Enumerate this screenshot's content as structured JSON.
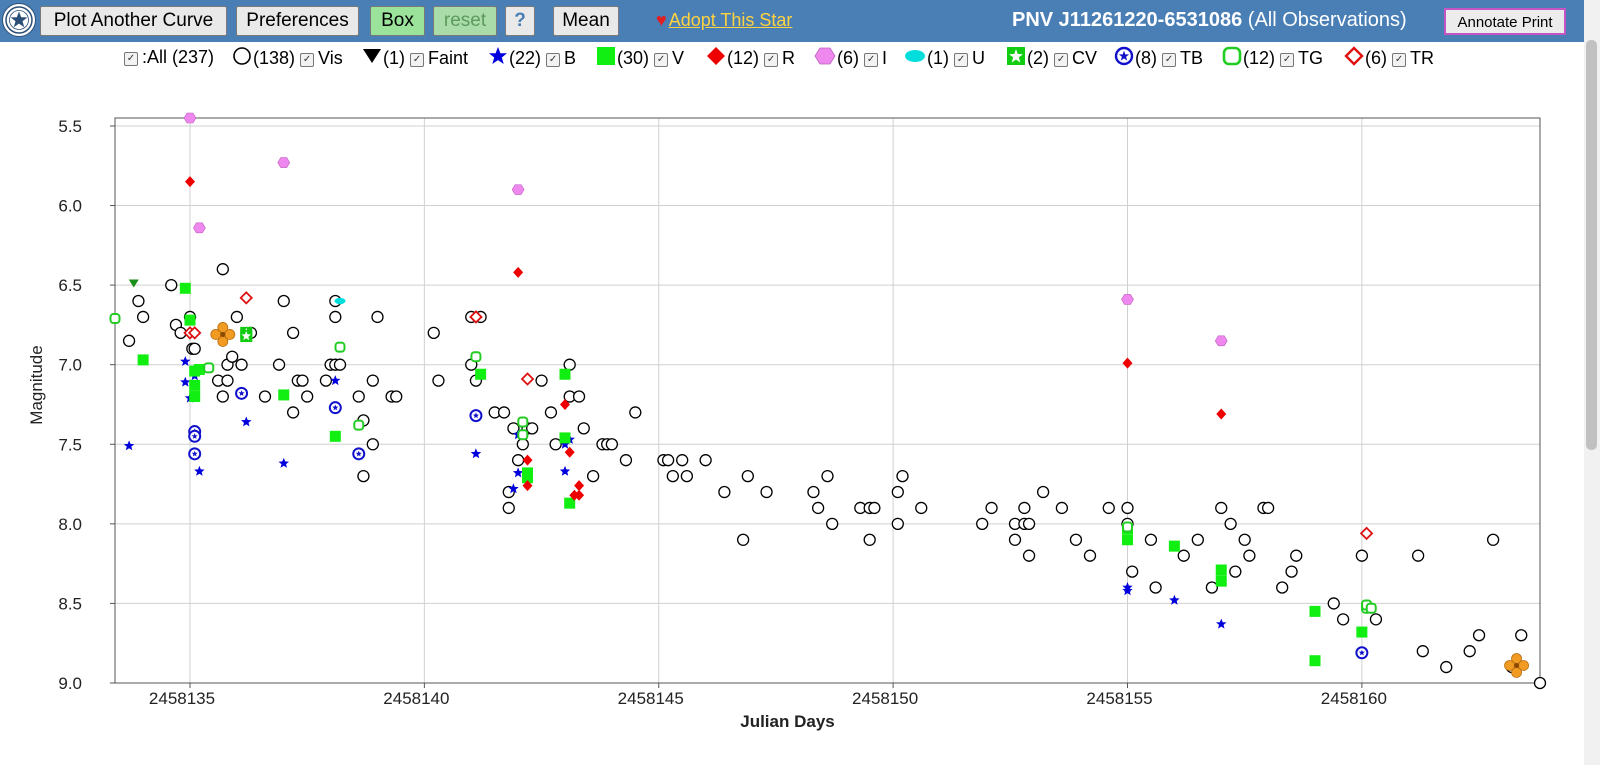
{
  "toolbar": {
    "plot_another_curve": "Plot Another Curve",
    "preferences": "Preferences",
    "box": "Box",
    "reset": "reset",
    "help": "?",
    "mean": "Mean",
    "adopt_heart": "♥",
    "adopt_label": "Adopt This Star",
    "star_name": "PNV J11261220-6531086",
    "star_suffix": "(All Observations)",
    "annotate_print": "Annotate Print"
  },
  "colors": {
    "toolbar_bg": "#4a7fb6",
    "vis": "#000000",
    "faint": "#1a8f1a",
    "B": "#0000dd",
    "V": "#11ee11",
    "R": "#ee0000",
    "I": "#ee88ee",
    "U": "#00dddd",
    "CV": "#11cc11",
    "TB": "#1111cc",
    "TG": "#22cc22",
    "TR": "#dd1111",
    "highlight": "#f29b22"
  },
  "legend": {
    "all": ":All (237)",
    "items": [
      {
        "key": "vis",
        "count": "(138)",
        "label": "Vis"
      },
      {
        "key": "faint",
        "count": "(1)",
        "label": "Faint"
      },
      {
        "key": "B",
        "count": "(22)",
        "label": "B"
      },
      {
        "key": "V",
        "count": "(30)",
        "label": "V"
      },
      {
        "key": "R",
        "count": "(12)",
        "label": "R"
      },
      {
        "key": "I",
        "count": "(6)",
        "label": "I"
      },
      {
        "key": "U",
        "count": "(1)",
        "label": "U"
      },
      {
        "key": "CV",
        "count": "(2)",
        "label": "CV"
      },
      {
        "key": "TB",
        "count": "(8)",
        "label": "TB"
      },
      {
        "key": "TG",
        "count": "(12)",
        "label": "TG"
      },
      {
        "key": "TR",
        "count": "(6)",
        "label": "TR"
      }
    ]
  },
  "chart_data": {
    "type": "scatter",
    "title": "",
    "xlabel": "Julian Days",
    "ylabel": "Magnitude",
    "xlim": [
      2458133.4,
      2458163.8
    ],
    "ylim": [
      5.45,
      9.0
    ],
    "y_inverted": true,
    "grid": true,
    "x_ticks": [
      2458135,
      2458140,
      2458145,
      2458150,
      2458155,
      2458160
    ],
    "x_tick_labels": [
      "2458135",
      "2458140",
      "2458145",
      "2458150",
      "2458155",
      "2458160"
    ],
    "y_ticks": [
      5.5,
      6.0,
      6.5,
      7.0,
      7.5,
      8.0,
      8.5,
      9.0
    ],
    "y_tick_labels": [
      "5.5",
      "6.0",
      "6.5",
      "7.0",
      "7.5",
      "8.0",
      "8.5",
      "9.0"
    ],
    "series": [
      {
        "name": "Vis",
        "marker": "open-circle",
        "points": [
          [
            2458133.7,
            6.85
          ],
          [
            2458133.9,
            6.6
          ],
          [
            2458134.0,
            6.7
          ],
          [
            2458134.6,
            6.5
          ],
          [
            2458134.7,
            6.75
          ],
          [
            2458134.8,
            6.8
          ],
          [
            2458135.0,
            6.7
          ],
          [
            2458135.05,
            6.9
          ],
          [
            2458135.1,
            6.9
          ],
          [
            2458135.6,
            7.1
          ],
          [
            2458135.7,
            7.2
          ],
          [
            2458135.7,
            6.4
          ],
          [
            2458135.8,
            7.1
          ],
          [
            2458135.8,
            7.0
          ],
          [
            2458135.9,
            6.95
          ],
          [
            2458136.0,
            6.7
          ],
          [
            2458136.1,
            7.0
          ],
          [
            2458136.3,
            6.8
          ],
          [
            2458136.6,
            7.2
          ],
          [
            2458136.9,
            7.0
          ],
          [
            2458137.0,
            6.6
          ],
          [
            2458137.2,
            6.8
          ],
          [
            2458137.2,
            7.3
          ],
          [
            2458137.3,
            7.1
          ],
          [
            2458137.4,
            7.1
          ],
          [
            2458137.5,
            7.2
          ],
          [
            2458137.9,
            7.1
          ],
          [
            2458138.0,
            7.0
          ],
          [
            2458138.1,
            6.6
          ],
          [
            2458138.1,
            6.7
          ],
          [
            2458138.1,
            7.0
          ],
          [
            2458138.2,
            7.0
          ],
          [
            2458138.6,
            7.2
          ],
          [
            2458138.7,
            7.35
          ],
          [
            2458138.7,
            7.7
          ],
          [
            2458138.9,
            7.1
          ],
          [
            2458138.9,
            7.5
          ],
          [
            2458139.0,
            6.7
          ],
          [
            2458139.3,
            7.2
          ],
          [
            2458139.4,
            7.2
          ],
          [
            2458140.2,
            6.8
          ],
          [
            2458140.3,
            7.1
          ],
          [
            2458141.0,
            6.7
          ],
          [
            2458141.0,
            7.0
          ],
          [
            2458141.1,
            7.1
          ],
          [
            2458141.2,
            6.7
          ],
          [
            2458141.5,
            7.3
          ],
          [
            2458141.7,
            7.3
          ],
          [
            2458141.8,
            7.9
          ],
          [
            2458141.8,
            7.8
          ],
          [
            2458141.9,
            7.4
          ],
          [
            2458142.0,
            7.6
          ],
          [
            2458142.1,
            7.5
          ],
          [
            2458142.2,
            7.4
          ],
          [
            2458142.3,
            7.4
          ],
          [
            2458142.5,
            7.1
          ],
          [
            2458142.7,
            7.3
          ],
          [
            2458142.8,
            7.5
          ],
          [
            2458143.1,
            7.0
          ],
          [
            2458143.1,
            7.2
          ],
          [
            2458143.3,
            7.2
          ],
          [
            2458143.4,
            7.4
          ],
          [
            2458143.6,
            7.7
          ],
          [
            2458143.8,
            7.5
          ],
          [
            2458143.9,
            7.5
          ],
          [
            2458144.0,
            7.5
          ],
          [
            2458144.3,
            7.6
          ],
          [
            2458144.5,
            7.3
          ],
          [
            2458145.1,
            7.6
          ],
          [
            2458145.2,
            7.6
          ],
          [
            2458145.3,
            7.7
          ],
          [
            2458145.5,
            7.6
          ],
          [
            2458145.6,
            7.7
          ],
          [
            2458146.0,
            7.6
          ],
          [
            2458146.4,
            7.8
          ],
          [
            2458146.8,
            8.1
          ],
          [
            2458146.9,
            7.7
          ],
          [
            2458147.3,
            7.8
          ],
          [
            2458148.3,
            7.8
          ],
          [
            2458148.4,
            7.9
          ],
          [
            2458148.6,
            7.7
          ],
          [
            2458148.7,
            8.0
          ],
          [
            2458149.3,
            7.9
          ],
          [
            2458149.5,
            8.1
          ],
          [
            2458149.5,
            7.9
          ],
          [
            2458149.6,
            7.9
          ],
          [
            2458150.1,
            7.8
          ],
          [
            2458150.1,
            8.0
          ],
          [
            2458150.2,
            7.7
          ],
          [
            2458150.6,
            7.9
          ],
          [
            2458151.9,
            8.0
          ],
          [
            2458152.1,
            7.9
          ],
          [
            2458152.6,
            8.1
          ],
          [
            2458152.6,
            8.0
          ],
          [
            2458152.8,
            7.9
          ],
          [
            2458152.8,
            8.0
          ],
          [
            2458152.9,
            8.2
          ],
          [
            2458152.9,
            8.0
          ],
          [
            2458153.2,
            7.8
          ],
          [
            2458153.6,
            7.9
          ],
          [
            2458153.9,
            8.1
          ],
          [
            2458154.2,
            8.2
          ],
          [
            2458154.6,
            7.9
          ],
          [
            2458155.0,
            8.0
          ],
          [
            2458155.0,
            7.9
          ],
          [
            2458155.1,
            8.3
          ],
          [
            2458155.5,
            8.1
          ],
          [
            2458155.6,
            8.4
          ],
          [
            2458156.2,
            8.2
          ],
          [
            2458156.5,
            8.1
          ],
          [
            2458156.8,
            8.4
          ],
          [
            2458157.0,
            7.9
          ],
          [
            2458157.2,
            8.0
          ],
          [
            2458157.3,
            8.3
          ],
          [
            2458157.5,
            8.1
          ],
          [
            2458157.6,
            8.2
          ],
          [
            2458157.9,
            7.9
          ],
          [
            2458158.0,
            7.9
          ],
          [
            2458158.3,
            8.4
          ],
          [
            2458158.5,
            8.3
          ],
          [
            2458158.6,
            8.2
          ],
          [
            2458159.4,
            8.5
          ],
          [
            2458159.6,
            8.6
          ],
          [
            2458160.0,
            8.2
          ],
          [
            2458160.3,
            8.6
          ],
          [
            2458161.2,
            8.2
          ],
          [
            2458161.3,
            8.8
          ],
          [
            2458161.8,
            8.9
          ],
          [
            2458162.3,
            8.8
          ],
          [
            2458162.5,
            8.7
          ],
          [
            2458162.8,
            8.1
          ],
          [
            2458163.2,
            8.9
          ],
          [
            2458163.4,
            8.7
          ],
          [
            2458163.8,
            9.0
          ]
        ]
      },
      {
        "name": "Faint",
        "marker": "triangle-down",
        "points": [
          [
            2458133.8,
            6.49
          ]
        ]
      },
      {
        "name": "B",
        "marker": "star",
        "points": [
          [
            2458133.7,
            7.51
          ],
          [
            2458134.9,
            6.98
          ],
          [
            2458134.9,
            7.11
          ],
          [
            2458135.0,
            7.21
          ],
          [
            2458135.1,
            7.07
          ],
          [
            2458135.2,
            7.67
          ],
          [
            2458136.2,
            7.36
          ],
          [
            2458137.0,
            7.62
          ],
          [
            2458138.1,
            7.1
          ],
          [
            2458141.1,
            7.56
          ],
          [
            2458141.9,
            7.78
          ],
          [
            2458142.0,
            7.44
          ],
          [
            2458142.0,
            7.68
          ],
          [
            2458142.1,
            7.44
          ],
          [
            2458142.2,
            7.71
          ],
          [
            2458143.0,
            7.67
          ],
          [
            2458143.0,
            7.5
          ],
          [
            2458143.1,
            7.47
          ],
          [
            2458155.0,
            8.42
          ],
          [
            2458155.0,
            8.4
          ],
          [
            2458156.0,
            8.48
          ],
          [
            2458157.0,
            8.63
          ]
        ]
      },
      {
        "name": "V",
        "marker": "square",
        "points": [
          [
            2458134.0,
            6.97
          ],
          [
            2458134.9,
            6.52
          ],
          [
            2458135.0,
            6.72
          ],
          [
            2458135.1,
            7.04
          ],
          [
            2458135.1,
            7.13
          ],
          [
            2458135.1,
            7.2
          ],
          [
            2458135.2,
            7.03
          ],
          [
            2458137.0,
            7.19
          ],
          [
            2458138.1,
            7.45
          ],
          [
            2458141.2,
            7.06
          ],
          [
            2458142.2,
            7.68
          ],
          [
            2458142.2,
            7.71
          ],
          [
            2458143.0,
            7.46
          ],
          [
            2458143.0,
            7.06
          ],
          [
            2458143.1,
            7.87
          ],
          [
            2458155.0,
            8.03
          ],
          [
            2458155.0,
            8.1
          ],
          [
            2458156.0,
            8.14
          ],
          [
            2458157.0,
            8.36
          ],
          [
            2458157.0,
            8.29
          ],
          [
            2458159.0,
            8.55
          ],
          [
            2458159.0,
            8.86
          ],
          [
            2458160.0,
            8.68
          ]
        ]
      },
      {
        "name": "R",
        "marker": "diamond",
        "points": [
          [
            2458135.0,
            5.85
          ],
          [
            2458135.1,
            6.8
          ],
          [
            2458142.0,
            6.42
          ],
          [
            2458142.2,
            7.6
          ],
          [
            2458142.2,
            7.76
          ],
          [
            2458143.0,
            7.25
          ],
          [
            2458143.1,
            7.55
          ],
          [
            2458143.2,
            7.82
          ],
          [
            2458143.3,
            7.82
          ],
          [
            2458143.3,
            7.76
          ],
          [
            2458155.0,
            6.99
          ],
          [
            2458157.0,
            7.31
          ]
        ]
      },
      {
        "name": "I",
        "marker": "hexagon",
        "points": [
          [
            2458135.0,
            5.45
          ],
          [
            2458135.2,
            6.14
          ],
          [
            2458137.0,
            5.73
          ],
          [
            2458142.0,
            5.9
          ],
          [
            2458155.0,
            6.59
          ],
          [
            2458157.0,
            6.85
          ]
        ]
      },
      {
        "name": "U",
        "marker": "ellipse",
        "points": [
          [
            2458138.2,
            6.6
          ]
        ]
      },
      {
        "name": "CV",
        "marker": "starburst-square",
        "points": [
          [
            2458136.2,
            6.8
          ],
          [
            2458136.2,
            6.82
          ]
        ]
      },
      {
        "name": "TB",
        "marker": "circled-star",
        "points": [
          [
            2458135.1,
            7.42
          ],
          [
            2458135.1,
            7.45
          ],
          [
            2458135.1,
            7.56
          ],
          [
            2458136.1,
            7.18
          ],
          [
            2458138.1,
            7.27
          ],
          [
            2458138.6,
            7.56
          ],
          [
            2458141.1,
            7.32
          ],
          [
            2458160.0,
            8.81
          ]
        ]
      },
      {
        "name": "TG",
        "marker": "open-rounded-square",
        "points": [
          [
            2458133.4,
            6.71
          ],
          [
            2458135.4,
            7.02
          ],
          [
            2458138.2,
            6.89
          ],
          [
            2458138.6,
            7.38
          ],
          [
            2458141.1,
            6.95
          ],
          [
            2458142.1,
            7.36
          ],
          [
            2458142.1,
            7.44
          ],
          [
            2458155.0,
            8.02
          ],
          [
            2458160.1,
            8.52
          ],
          [
            2458160.1,
            8.53
          ],
          [
            2458160.1,
            8.51
          ],
          [
            2458160.2,
            8.53
          ]
        ]
      },
      {
        "name": "TR",
        "marker": "open-diamond",
        "points": [
          [
            2458135.0,
            6.8
          ],
          [
            2458135.1,
            6.8
          ],
          [
            2458136.2,
            6.58
          ],
          [
            2458141.1,
            6.7
          ],
          [
            2458142.2,
            7.09
          ],
          [
            2458160.1,
            8.06
          ]
        ]
      },
      {
        "name": "",
        "marker": "highlight-cross",
        "points": [
          [
            2458135.7,
            6.81
          ],
          [
            2458163.3,
            8.89
          ]
        ]
      }
    ]
  }
}
